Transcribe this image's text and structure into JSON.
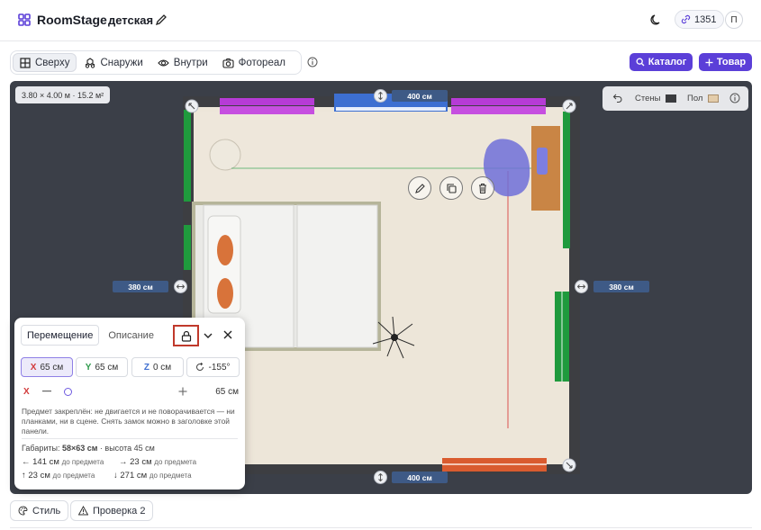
{
  "app": {
    "name": "RoomStage",
    "project": "детская",
    "credits": "1351",
    "avatar": "П"
  },
  "view_tabs": [
    {
      "label": "Сверху",
      "icon": "grid-icon",
      "active": true
    },
    {
      "label": "Снаружи",
      "icon": "cubes-icon",
      "active": false
    },
    {
      "label": "Внутри",
      "icon": "eye-icon",
      "active": false
    },
    {
      "label": "Фотореал",
      "icon": "camera-icon",
      "active": false
    }
  ],
  "actions": {
    "catalog": "Каталог",
    "product": "Товар"
  },
  "canvas": {
    "area": "3.80 × 4.00 м · 15.2 м²",
    "legend": {
      "walls": "Стены",
      "floor": "Пол"
    },
    "colors": {
      "walls": "#3a3b3e",
      "floor": "#e3ccaa",
      "accent": "#5b3fd8"
    },
    "dims": {
      "top": "400 см",
      "bottom": "400 см",
      "left": "380 см",
      "right": "380 см"
    }
  },
  "panel": {
    "tabs": [
      "Перемещение",
      "Описание"
    ],
    "coords": {
      "x": "65 см",
      "y": "65 см",
      "z": "0 см",
      "rot": "-155°"
    },
    "axis_labels": {
      "x": "X",
      "y": "Y",
      "z": "Z"
    },
    "slider": {
      "axis": "X",
      "value": "65 см"
    },
    "lock_note": "Предмет закреплён: не двигается и не поворачивается — ни планками, ни в сцене. Снять замок можно в заголовке этой панели.",
    "dims_label": "Габариты:",
    "dims_value": "58×63 см",
    "height_text": " · высота 45 см",
    "distances": {
      "left": "141 см",
      "right": "23 см",
      "up": "23 см",
      "down": "271 см",
      "suffix": "до предмета"
    }
  },
  "bottom": {
    "style": "Стиль",
    "check": "Проверка 2"
  }
}
